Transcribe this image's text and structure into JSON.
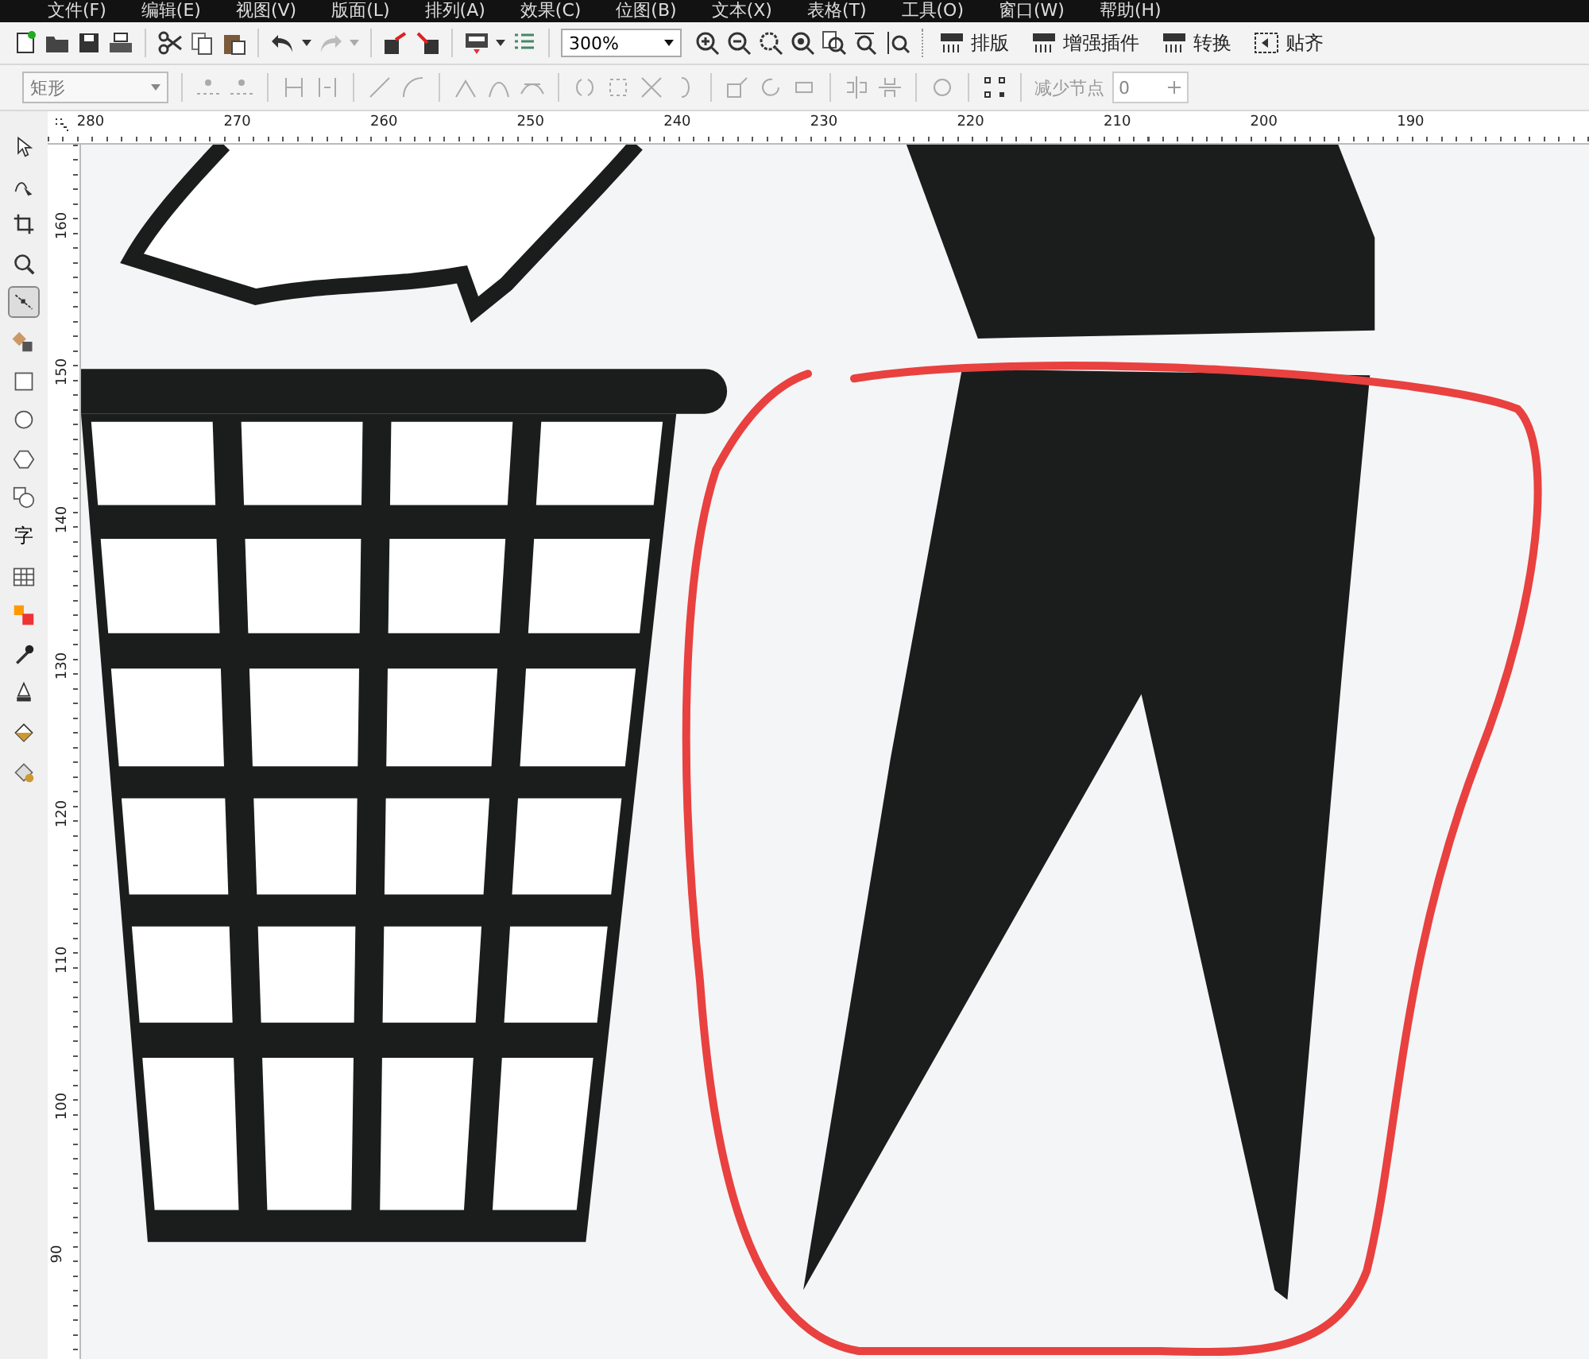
{
  "menu": [
    "文件(F)",
    "编辑(E)",
    "视图(V)",
    "版面(L)",
    "排列(A)",
    "效果(C)",
    "位图(B)",
    "文本(X)",
    "表格(T)",
    "工具(O)",
    "窗口(W)",
    "帮助(H)"
  ],
  "standard_toolbar": {
    "zoom": "300%",
    "plugins": [
      "排版",
      "增强插件",
      "转换",
      "贴齐"
    ]
  },
  "property_bar": {
    "shape": "矩形",
    "reduce_nodes_label": "减少节点",
    "reduce_nodes_value": "0"
  },
  "horizontal_ruler": [
    "280",
    "270",
    "260",
    "250",
    "240",
    "230",
    "220",
    "210",
    "200",
    "190"
  ],
  "vertical_ruler": [
    "160",
    "150",
    "140",
    "130",
    "120",
    "110",
    "100",
    "90"
  ],
  "tools": [
    {
      "kind": "pick",
      "selected": false
    },
    {
      "kind": "freehand",
      "selected": false
    },
    {
      "kind": "crop",
      "selected": false
    },
    {
      "kind": "zoom",
      "selected": false
    },
    {
      "kind": "shape",
      "selected": true
    },
    {
      "kind": "smart",
      "selected": false
    },
    {
      "kind": "rectangle",
      "selected": false
    },
    {
      "kind": "ellipse",
      "selected": false
    },
    {
      "kind": "polygon",
      "selected": false
    },
    {
      "kind": "basic",
      "selected": false
    },
    {
      "kind": "text",
      "glyph": "字",
      "selected": false
    },
    {
      "kind": "table",
      "selected": false
    },
    {
      "kind": "blend",
      "selected": false
    },
    {
      "kind": "eyedropper",
      "selected": false
    },
    {
      "kind": "outline",
      "selected": false
    },
    {
      "kind": "fill",
      "selected": false
    },
    {
      "kind": "interactive",
      "selected": false
    }
  ]
}
